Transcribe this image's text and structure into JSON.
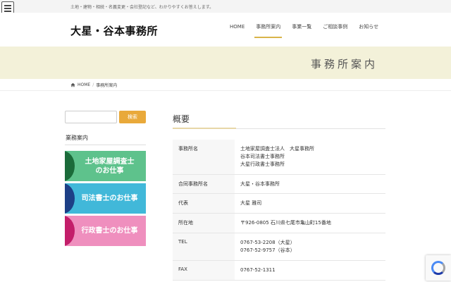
{
  "topbar": {
    "tagline": "土地・建物・相続・名義変更・会社登記など、わかりやすくお答えします。"
  },
  "header": {
    "logo": "大星・谷本事務所",
    "nav": [
      {
        "label": "HOME"
      },
      {
        "label": "事務所案内"
      },
      {
        "label": "事業一覧"
      },
      {
        "label": "ご相談事例"
      },
      {
        "label": "お知らせ"
      }
    ],
    "active_nav": "事務所案内"
  },
  "banner": {
    "title": "事務所案内"
  },
  "breadcrumb": {
    "home": "HOME",
    "current": "事務所案内"
  },
  "sidebar": {
    "search_placeholder": "",
    "search_button": "検索",
    "heading": "業務案内",
    "services": [
      {
        "label": "土地家屋調査士\nのお仕事",
        "color": "#5ec28c"
      },
      {
        "label": "司法書士のお仕事",
        "color": "#41b8d9"
      },
      {
        "label": "行政書士のお仕事",
        "color": "#ef8fbe"
      }
    ]
  },
  "main": {
    "section_title": "概要",
    "rows": [
      {
        "label": "事務所名",
        "value": "土地家屋調査士法人　大星事務所\n谷本司法書士事務所\n大星行政書士事務所"
      },
      {
        "label": "合同事務所名",
        "value": "大星・谷本事務所"
      },
      {
        "label": "代表",
        "value": "大星 雅司"
      },
      {
        "label": "所在地",
        "value": "〒926-0805 石川県七尾市亀山町15番地"
      },
      {
        "label": "TEL",
        "value": "0767-53-2208（大星）\n0767-52-9757（谷本）"
      },
      {
        "label": "FAX",
        "value": "0767-52-1311"
      }
    ]
  },
  "colors": {
    "accent": "#d9b44a",
    "search_button": "#e9a93a",
    "banner_bg": "#f3f1d9"
  }
}
